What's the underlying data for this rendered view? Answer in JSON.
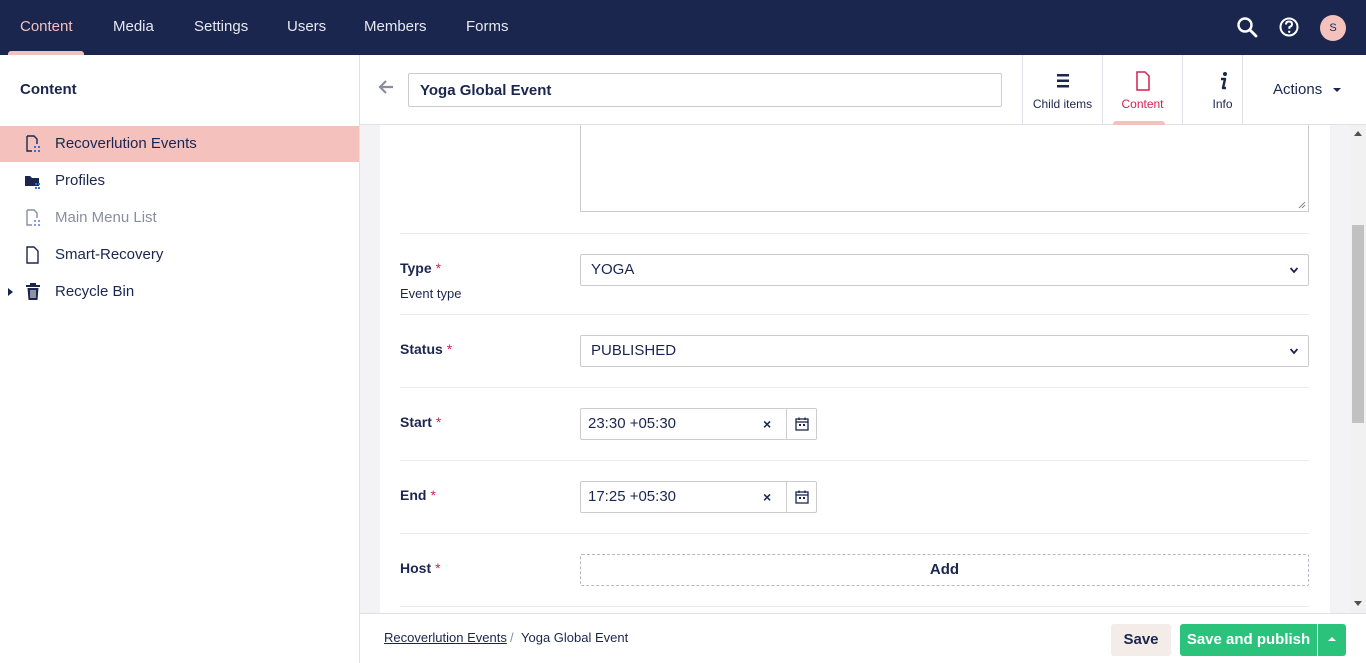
{
  "topnav": {
    "items": [
      "Content",
      "Media",
      "Settings",
      "Users",
      "Members",
      "Forms"
    ],
    "active": "Content",
    "avatar_initial": "S",
    "icons": [
      "search-icon",
      "help-icon"
    ]
  },
  "sidebar": {
    "title": "Content",
    "items": [
      {
        "label": "Recoverlution Events",
        "icon": "document-list-icon",
        "selected": true
      },
      {
        "label": "Profiles",
        "icon": "folder-icon"
      },
      {
        "label": "Main Menu List",
        "icon": "document-list-icon",
        "muted": true
      },
      {
        "label": "Smart-Recovery",
        "icon": "document-icon"
      },
      {
        "label": "Recycle Bin",
        "icon": "trash-icon",
        "expandable": true
      }
    ]
  },
  "header": {
    "name_value": "Yoga Global Event",
    "apps": [
      {
        "label": "Child items",
        "icon": "list-icon"
      },
      {
        "label": "Content",
        "icon": "document-icon",
        "active": true
      },
      {
        "label": "Info",
        "icon": "info-icon"
      }
    ],
    "actions_label": "Actions"
  },
  "properties": {
    "type": {
      "label": "Type",
      "required_mark": "*",
      "description": "Event type",
      "value": "YOGA"
    },
    "status": {
      "label": "Status",
      "required_mark": "*",
      "value": "PUBLISHED"
    },
    "start": {
      "label": "Start",
      "required_mark": "*",
      "value": "23:30 +05:30",
      "clear": "×"
    },
    "end": {
      "label": "End",
      "required_mark": "*",
      "value": "17:25 +05:30",
      "clear": "×"
    },
    "host": {
      "label": "Host",
      "required_mark": "*",
      "add_label": "Add"
    }
  },
  "footer": {
    "breadcrumb": [
      "Recoverlution Events",
      "Yoga Global Event"
    ],
    "separator": "/",
    "save_label": "Save",
    "publish_label": "Save and publish"
  },
  "colors": {
    "nav_bg": "#1b264f",
    "accent_pink": "#f5c1bc",
    "publish_green": "#2bc37c",
    "required_red": "#d42054"
  }
}
